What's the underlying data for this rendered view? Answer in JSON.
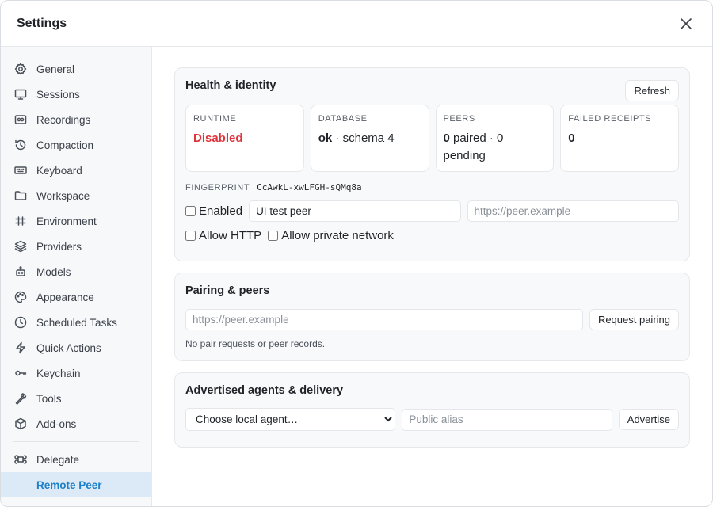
{
  "window": {
    "title": "Settings"
  },
  "sidebar": {
    "items": [
      {
        "label": "General",
        "icon": "gear-icon"
      },
      {
        "label": "Sessions",
        "icon": "monitor-icon"
      },
      {
        "label": "Recordings",
        "icon": "recording-icon"
      },
      {
        "label": "Compaction",
        "icon": "history-icon"
      },
      {
        "label": "Keyboard",
        "icon": "keyboard-icon"
      },
      {
        "label": "Workspace",
        "icon": "folder-icon"
      },
      {
        "label": "Environment",
        "icon": "variable-icon"
      },
      {
        "label": "Providers",
        "icon": "layers-icon"
      },
      {
        "label": "Models",
        "icon": "robot-icon"
      },
      {
        "label": "Appearance",
        "icon": "palette-icon"
      },
      {
        "label": "Scheduled Tasks",
        "icon": "clock-icon"
      },
      {
        "label": "Quick Actions",
        "icon": "lightning-icon"
      },
      {
        "label": "Keychain",
        "icon": "key-icon"
      },
      {
        "label": "Tools",
        "icon": "wrench-icon"
      },
      {
        "label": "Add-ons",
        "icon": "package-icon"
      }
    ],
    "secondary": [
      {
        "label": "Delegate",
        "icon": "command-icon"
      },
      {
        "label": "Remote Peer",
        "icon": ""
      }
    ],
    "active": "Remote Peer",
    "active_color": "#1d7fc8"
  },
  "health": {
    "title": "Health & identity",
    "refresh_label": "Refresh",
    "stats": {
      "runtime": {
        "label": "RUNTIME",
        "value": "Disabled",
        "color": "#e0343b"
      },
      "database": {
        "label": "DATABASE",
        "status": "ok",
        "detail": "· schema 4"
      },
      "peers": {
        "label": "PEERS",
        "paired_count": "0",
        "paired_text": "paired · 0 pending"
      },
      "failed": {
        "label": "FAILED RECEIPTS",
        "value": "0"
      }
    },
    "fingerprint_label": "FINGERPRINT",
    "fingerprint_value": "CcAwkL-xwLFGH-sQMq8a",
    "enabled_label": "Enabled",
    "enabled_checked": false,
    "peer_name_value": "UI test peer",
    "peer_url_placeholder": "https://peer.example",
    "allow_http_label": "Allow HTTP",
    "allow_http_checked": false,
    "allow_private_label": "Allow private network",
    "allow_private_checked": false
  },
  "pairing": {
    "title": "Pairing & peers",
    "url_placeholder": "https://peer.example",
    "request_label": "Request pairing",
    "empty_text": "No pair requests or peer records."
  },
  "agents": {
    "title": "Advertised agents & delivery",
    "select_value": "Choose local agent…",
    "alias_placeholder": "Public alias",
    "advertise_label": "Advertise"
  }
}
